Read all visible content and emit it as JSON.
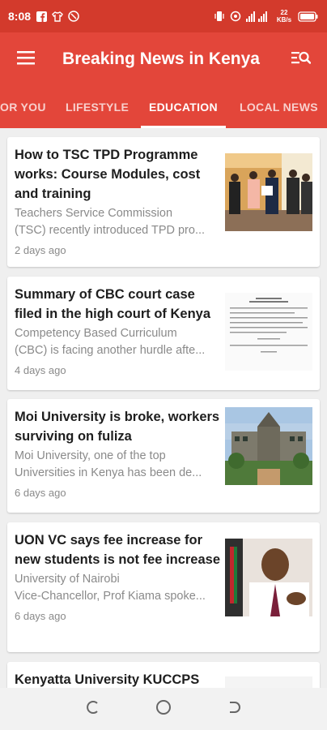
{
  "status_bar": {
    "time": "8:08",
    "network": "22 KB/s",
    "icons_left": [
      "facebook-icon",
      "shirt-icon",
      "vpn-icon"
    ],
    "icons_right": [
      "vibrate-icon",
      "hotspot-icon",
      "signal-icon",
      "signal-icon",
      "battery-icon"
    ]
  },
  "app_bar": {
    "title": "Breaking News in Kenya",
    "left_icon": "menu-icon",
    "right_icon": "search-list-icon"
  },
  "tabs": [
    {
      "label": "OR YOU",
      "active": false
    },
    {
      "label": "LIFESTYLE",
      "active": false
    },
    {
      "label": "EDUCATION",
      "active": true
    },
    {
      "label": "LOCAL NEWS",
      "active": false
    }
  ],
  "articles": [
    {
      "headline": "How to TSC TPD Programme works: Course Modules, cost and training",
      "summary_line1": "Teachers Service Commission",
      "summary_line2": "(TSC) recently introduced TPD pro...",
      "time": "2 days ago"
    },
    {
      "headline": "Summary of CBC court case filed in the high court of Kenya",
      "summary_line1": "Competency Based Curriculum",
      "summary_line2": "(CBC) is facing another hurdle afte...",
      "time": "4 days ago"
    },
    {
      "headline": "Moi University is broke, workers surviving on fuliza",
      "summary_line1": "Moi University, one of the top",
      "summary_line2": "Universities in Kenya has been de...",
      "time": "6 days ago"
    },
    {
      "headline": "UON VC says fee increase for new students is not fee increase",
      "summary_line1": "University of Nairobi",
      "summary_line2": "Vice-Chancellor, Prof Kiama spoke...",
      "time": "6 days ago"
    },
    {
      "headline": "Kenyatta University KUCCPS",
      "summary_line1": "",
      "summary_line2": "",
      "time": ""
    }
  ],
  "nav_bar": {
    "buttons": [
      "recent-apps-icon",
      "home-icon",
      "back-icon"
    ]
  },
  "colors": {
    "accent": "#e3463a",
    "status_bar": "#d33a2c",
    "background": "#efefef"
  }
}
